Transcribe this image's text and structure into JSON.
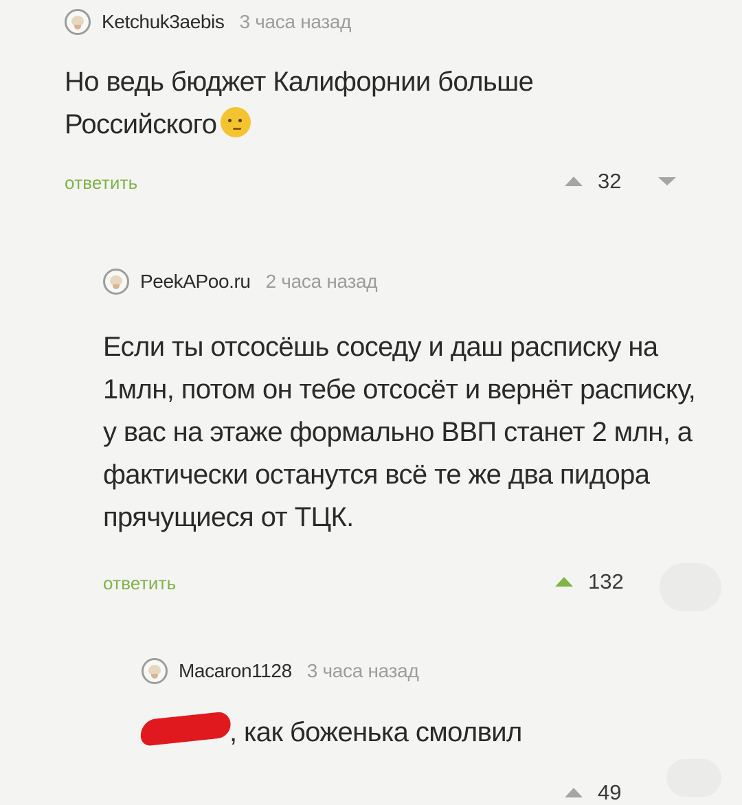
{
  "comments": [
    {
      "author": "Ketchuk3aebis",
      "time": "3 часа назад",
      "text": "Но ведь бюджет Калифорнии больше Российского",
      "emoji": "thinking-face",
      "reply_label": "ответить",
      "score": "32"
    },
    {
      "author": "PeekAPoo.ru",
      "time": "2 часа назад",
      "text": "Если ты отсосёшь соседу и даш расписку на 1млн, потом он тебе отсосёт и вернёт расписку, у вас на этаже формально ВВП станет 2 млн, а фактически останутся всё те же два пидора прячущиеся от ТЦК.",
      "reply_label": "ответить",
      "score": "132"
    },
    {
      "author": "Macaron1128",
      "time": "3 часа назад",
      "text": ", как боженька смолвил",
      "redacted": true,
      "score": "49"
    }
  ],
  "colors": {
    "reply_link": "#80b24a",
    "upvote_active": "#82b548",
    "vote_inactive": "#a5a5a5",
    "redaction": "#e0191e"
  }
}
